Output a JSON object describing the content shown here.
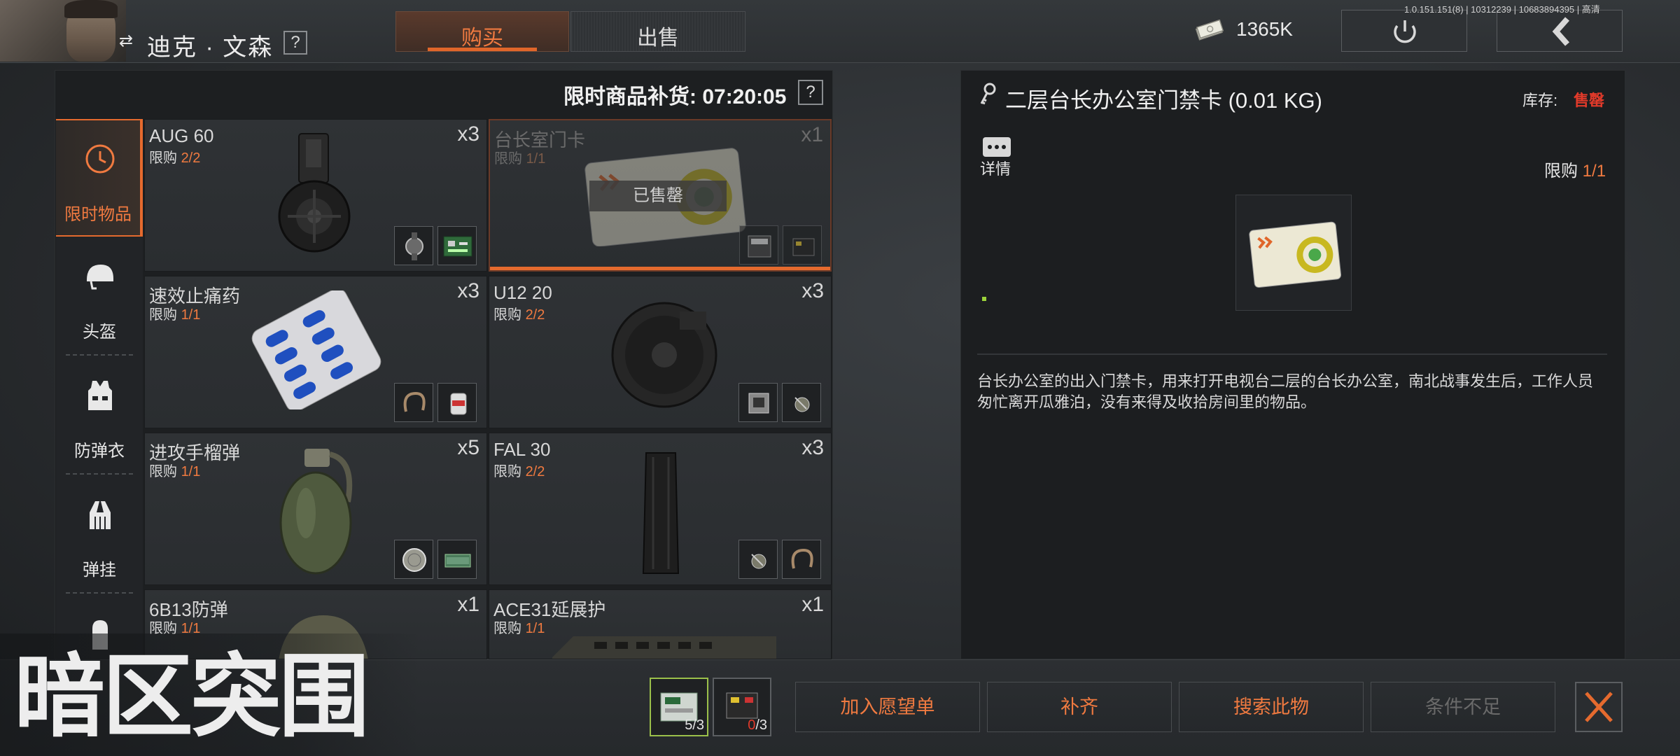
{
  "version": "1.0.151.151(8) | 10312239 | 10683894395 | 高清",
  "header": {
    "character_name": "迪克 · 文森",
    "help_mark": "?",
    "tabs": [
      {
        "label": "购买",
        "active": true
      },
      {
        "label": "出售",
        "active": false
      }
    ],
    "money": "1365K",
    "icons": [
      "swap-icon",
      "cash-icon",
      "power-icon",
      "back-chevron-icon"
    ]
  },
  "shop": {
    "restock_label": "限时商品补货: 07:20:05",
    "help_mark": "?",
    "categories": [
      {
        "label": "限时物品",
        "icon": "clock-icon",
        "active": true
      },
      {
        "label": "头盔",
        "icon": "helmet-icon",
        "active": false
      },
      {
        "label": "防弹衣",
        "icon": "vest-icon",
        "active": false
      },
      {
        "label": "弹挂",
        "icon": "chest-rig-icon",
        "active": false
      }
    ],
    "items": [
      {
        "name": "AUG 60",
        "limit_label": "限购",
        "limit": "2/2",
        "qty": "x3",
        "sold_out": false
      },
      {
        "name": "台长室门卡",
        "limit_label": "限购",
        "limit": "1/1",
        "qty": "x1",
        "sold_out": true,
        "sold_tag": "已售罄"
      },
      {
        "name": "速效止痛药",
        "limit_label": "限购",
        "limit": "1/1",
        "qty": "x3",
        "sold_out": false
      },
      {
        "name": "U12 20",
        "limit_label": "限购",
        "limit": "2/2",
        "qty": "x3",
        "sold_out": false
      },
      {
        "name": "进攻手榴弹",
        "limit_label": "限购",
        "limit": "1/1",
        "qty": "x5",
        "sold_out": false
      },
      {
        "name": "FAL 30",
        "limit_label": "限购",
        "limit": "2/2",
        "qty": "x3",
        "sold_out": false
      },
      {
        "name": "6B13防弹",
        "limit_label": "限购",
        "limit": "1/1",
        "qty": "x1",
        "sold_out": false
      },
      {
        "name": "ACE31延展护",
        "limit_label": "限购",
        "limit": "1/1",
        "qty": "x1",
        "sold_out": false
      }
    ]
  },
  "detail": {
    "title": "二层台长办公室门禁卡 (0.01 KG)",
    "stock_label": "库存:",
    "stock_value": "售罄",
    "detail_label": "详情",
    "limit_label": "限购",
    "limit_value": "1/1",
    "description": "台长办公室的出入门禁卡，用来打开电视台二层的台长办公室，南北战事发生后，工作人员匆忙离开瓜雅泊，没有来得及收拾房间里的物品。"
  },
  "bottom": {
    "materials": [
      {
        "count": "5/3",
        "owned_ok": true
      },
      {
        "count_owned": "0",
        "count_total": "/3",
        "owned_ok": false
      }
    ],
    "actions": [
      {
        "label": "加入愿望单",
        "enabled": true
      },
      {
        "label": "补齐",
        "enabled": true
      },
      {
        "label": "搜索此物",
        "enabled": true
      },
      {
        "label": "条件不足",
        "enabled": false
      }
    ]
  },
  "logo_text": "暗区突围",
  "colors": {
    "accent": "#e56a2e",
    "accent_text": "#f07a40",
    "alert": "#e23a2a",
    "panel": "#1d1f21"
  }
}
